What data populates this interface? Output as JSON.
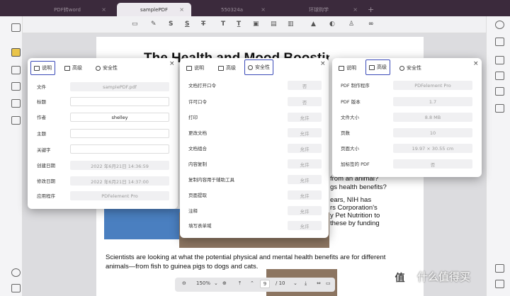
{
  "tabs": [
    {
      "label": "PDF转word"
    },
    {
      "label": "samplePDF"
    },
    {
      "label": "550324a"
    },
    {
      "label": "环球购学"
    }
  ],
  "zoom": {
    "percent": "150%",
    "page_current": "9",
    "page_total": "/ 10"
  },
  "page": {
    "title": "The Health and Mood Boosting",
    "text_lines": [
      "from an animal?",
      "gs health benefits?",
      "ears, NIH has",
      "rs Corporation's",
      "y Pet Nutrition to",
      "these by funding",
      "Scientists are looking at what the potential physical and mental health benefits are for different",
      "animals—from fish to guinea pigs to dogs and cats."
    ]
  },
  "dialog1": {
    "tabs": [
      "说明",
      "高级",
      "安全性"
    ],
    "close": "×",
    "fields": [
      {
        "label": "文件",
        "value": "samplePDF.pdf"
      },
      {
        "label": "标题",
        "value": ""
      },
      {
        "label": "作者",
        "value": "shelley"
      },
      {
        "label": "主题",
        "value": ""
      },
      {
        "label": "关键字",
        "value": ""
      },
      {
        "label": "创建日期",
        "value": "2022 年6月21日 14:36:59"
      },
      {
        "label": "修改日期",
        "value": "2022 年6月21日 14:37:00"
      },
      {
        "label": "应用程序",
        "value": "PDFelement Pro"
      }
    ]
  },
  "dialog2": {
    "tabs": [
      "说明",
      "高级",
      "安全性"
    ],
    "close": "×",
    "fields": [
      {
        "label": "文档打开口令",
        "value": "否"
      },
      {
        "label": "许可口令",
        "value": "否"
      },
      {
        "label": "打印",
        "value": "允许"
      },
      {
        "label": "更改文档",
        "value": "允许"
      },
      {
        "label": "文档组合",
        "value": "允许"
      },
      {
        "label": "内容复制",
        "value": "允许"
      },
      {
        "label": "复制内容用于辅助工具",
        "value": "允许"
      },
      {
        "label": "页面提取",
        "value": "允许"
      },
      {
        "label": "注释",
        "value": "允许"
      },
      {
        "label": "填写表单域",
        "value": "允许"
      }
    ]
  },
  "dialog3": {
    "tabs": [
      "说明",
      "高级",
      "安全性"
    ],
    "close": "×",
    "fields": [
      {
        "label": "PDF 制作程序",
        "value": "PDFelement Pro"
      },
      {
        "label": "PDF 版本",
        "value": "1.7"
      },
      {
        "label": "文件大小",
        "value": "8.8 MB"
      },
      {
        "label": "页数",
        "value": "10"
      },
      {
        "label": "页面大小",
        "value": "19.97 × 30.55 cm"
      },
      {
        "label": "加标签的 PDF",
        "value": "否"
      }
    ]
  },
  "watermark": {
    "badge": "值",
    "text": "什么值得买"
  },
  "toolbar_icons": [
    "comment-icon",
    "pen-icon",
    "strikethrough-icon",
    "underline-icon",
    "text-strike-icon",
    "textbox-icon",
    "text-format-icon",
    "callout-icon",
    "note-icon",
    "highlight-area-icon",
    "stamp-icon",
    "shape-icon",
    "user-icon",
    "link-icon",
    "more-icon"
  ],
  "colors": {
    "tabbar": "#3b2a3c",
    "accent": "#3a4ab8",
    "sidebar_active": "#e9c44a"
  }
}
